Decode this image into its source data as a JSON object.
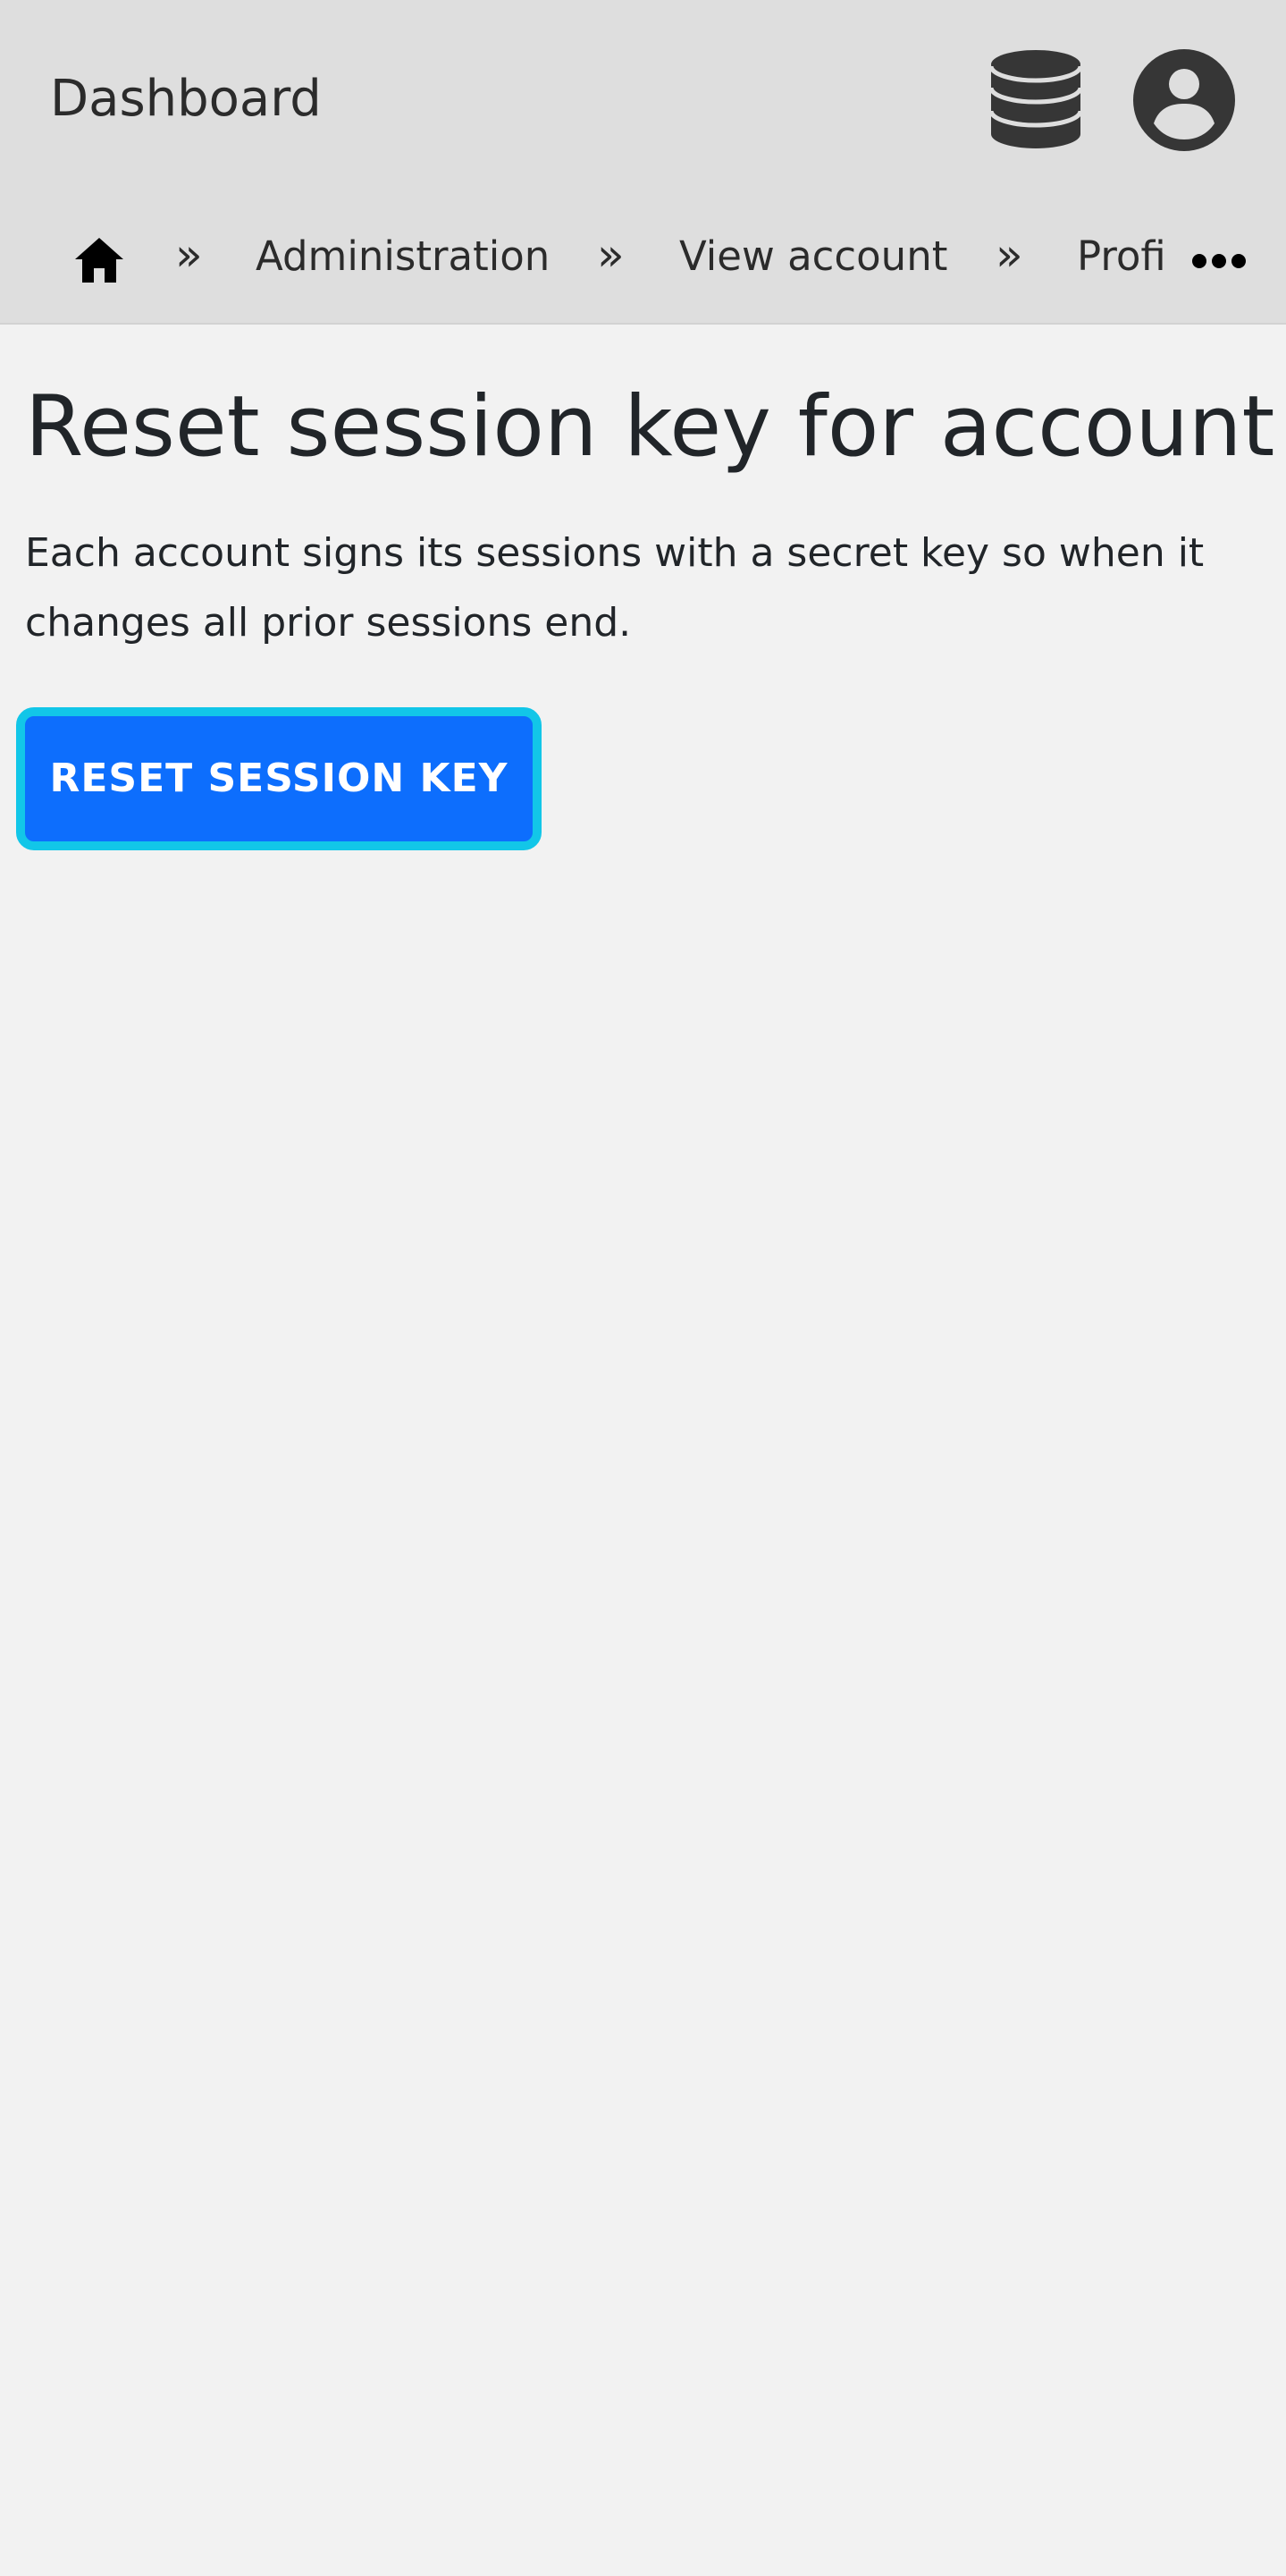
{
  "header": {
    "app_title": "Dashboard",
    "icons": {
      "database": "database-icon",
      "user": "user-circle-icon"
    }
  },
  "breadcrumb": {
    "home_icon": "home-icon",
    "separator": "»",
    "items": [
      "Administration",
      "View account",
      "Profi"
    ],
    "more_icon": "ellipsis-icon"
  },
  "main": {
    "title": "Reset session key for account",
    "description": "Each account signs its sessions with a secret key so when it changes all prior sessions end.",
    "reset_button_label": "RESET SESSION KEY"
  },
  "colors": {
    "header_bg": "#dedede",
    "page_bg": "#f2f2f2",
    "primary": "#0d6efd",
    "focus_ring": "#12c6e8",
    "icon": "#363636"
  }
}
